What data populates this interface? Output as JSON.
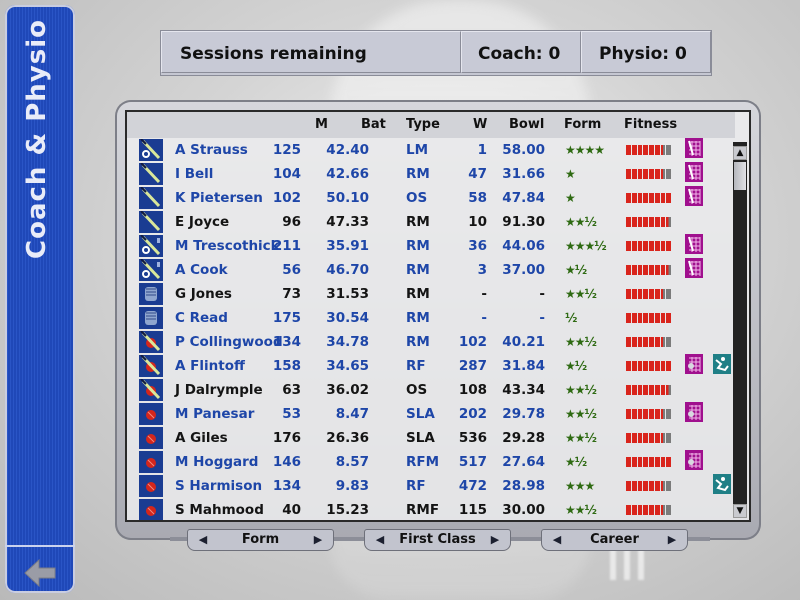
{
  "sidebar": {
    "title": "Coach & Physio",
    "back_icon": "back-arrow-icon"
  },
  "status": {
    "sessions_label": "Sessions remaining",
    "coach_label": "Coach: 0",
    "physio_label": "Physio: 0"
  },
  "table": {
    "headers": {
      "m": "M",
      "bat": "Bat",
      "type": "Type",
      "w": "W",
      "bowl": "Bowl",
      "form": "Form",
      "fitness": "Fitness"
    },
    "rows": [
      {
        "role": "batsman-wk-opener",
        "name": "A Strauss",
        "m": "125",
        "bat": "42.40",
        "type": "LM",
        "w": "1",
        "bowl": "58.00",
        "form": "★★★★",
        "fitness": "6.5/8",
        "coach": "batting-net-icon",
        "physio": "",
        "selected": true
      },
      {
        "role": "batsman",
        "name": "I Bell",
        "m": "104",
        "bat": "42.66",
        "type": "RM",
        "w": "47",
        "bowl": "31.66",
        "form": "★",
        "fitness": "6.5/8",
        "coach": "batting-net-icon",
        "physio": "",
        "selected": true
      },
      {
        "role": "batsman",
        "name": "K Pietersen",
        "m": "102",
        "bat": "50.10",
        "type": "OS",
        "w": "58",
        "bowl": "47.84",
        "form": "★",
        "fitness": "8/8",
        "coach": "batting-net-icon",
        "physio": "",
        "selected": true
      },
      {
        "role": "batsman",
        "name": "E Joyce",
        "m": "96",
        "bat": "47.33",
        "type": "RM",
        "w": "10",
        "bowl": "91.30",
        "form": "★★½",
        "fitness": "7.5/8",
        "coach": "",
        "physio": "",
        "selected": false
      },
      {
        "role": "batsman-opener-captain",
        "name": "M Trescothick",
        "m": "211",
        "bat": "35.91",
        "type": "RM",
        "w": "36",
        "bowl": "44.06",
        "form": "★★★½",
        "fitness": "8/8",
        "coach": "batting-net-icon",
        "physio": "",
        "selected": true
      },
      {
        "role": "batsman-opener-captain",
        "name": "A Cook",
        "m": "56",
        "bat": "46.70",
        "type": "RM",
        "w": "3",
        "bowl": "37.00",
        "form": "★½",
        "fitness": "7.5/8",
        "coach": "batting-net-icon",
        "physio": "",
        "selected": true
      },
      {
        "role": "wicketkeeper",
        "name": "G Jones",
        "m": "73",
        "bat": "31.53",
        "type": "RM",
        "w": "-",
        "bowl": "-",
        "form": "★★½",
        "fitness": "6.5/8",
        "coach": "",
        "physio": "",
        "selected": false
      },
      {
        "role": "wicketkeeper",
        "name": "C Read",
        "m": "175",
        "bat": "30.54",
        "type": "RM",
        "w": "-",
        "bowl": "-",
        "form": "½",
        "fitness": "8/8",
        "coach": "",
        "physio": "",
        "selected": true
      },
      {
        "role": "all-rounder",
        "name": "P Collingwood",
        "m": "134",
        "bat": "34.78",
        "type": "RM",
        "w": "102",
        "bowl": "40.21",
        "form": "★★½",
        "fitness": "6.5/8",
        "coach": "",
        "physio": "",
        "selected": true
      },
      {
        "role": "all-rounder",
        "name": "A Flintoff",
        "m": "158",
        "bat": "34.65",
        "type": "RF",
        "w": "287",
        "bowl": "31.84",
        "form": "★½",
        "fitness": "8/8",
        "coach": "bowling-net-icon",
        "physio": "physio-treatment-icon",
        "selected": true
      },
      {
        "role": "all-rounder",
        "name": "J Dalrymple",
        "m": "63",
        "bat": "36.02",
        "type": "OS",
        "w": "108",
        "bowl": "43.34",
        "form": "★★½",
        "fitness": "7.5/8",
        "coach": "",
        "physio": "",
        "selected": false
      },
      {
        "role": "bowler",
        "name": "M Panesar",
        "m": "53",
        "bat": "8.47",
        "type": "SLA",
        "w": "202",
        "bowl": "29.78",
        "form": "★★½",
        "fitness": "6.5/8",
        "coach": "bowling-net-icon",
        "physio": "",
        "selected": true
      },
      {
        "role": "bowler",
        "name": "A Giles",
        "m": "176",
        "bat": "26.36",
        "type": "SLA",
        "w": "536",
        "bowl": "29.28",
        "form": "★★½",
        "fitness": "6.5/8",
        "coach": "",
        "physio": "",
        "selected": false
      },
      {
        "role": "bowler",
        "name": "M Hoggard",
        "m": "146",
        "bat": "8.57",
        "type": "RFM",
        "w": "517",
        "bowl": "27.64",
        "form": "★½",
        "fitness": "8/8",
        "coach": "bowling-net-icon",
        "physio": "",
        "selected": true
      },
      {
        "role": "bowler",
        "name": "S Harmison",
        "m": "134",
        "bat": "9.83",
        "type": "RF",
        "w": "472",
        "bowl": "28.98",
        "form": "★★★",
        "fitness": "6.5/8",
        "coach": "",
        "physio": "physio-treatment-icon",
        "selected": true
      },
      {
        "role": "bowler",
        "name": "S Mahmood",
        "m": "40",
        "bat": "15.23",
        "type": "RMF",
        "w": "115",
        "bowl": "30.00",
        "form": "★★½",
        "fitness": "6.5/8",
        "coach": "",
        "physio": "",
        "selected": false
      }
    ]
  },
  "selectors": [
    {
      "label": "Form"
    },
    {
      "label": "First Class"
    },
    {
      "label": "Career"
    }
  ],
  "colors": {
    "selected_text": "#1e46a8",
    "normal_text": "#141414",
    "sidebar": "#2450c0",
    "form_star": "#2e6a12",
    "fitness_red": "#d9241c",
    "coach_icon": "#a0108e",
    "physio_icon": "#1f7f86"
  }
}
